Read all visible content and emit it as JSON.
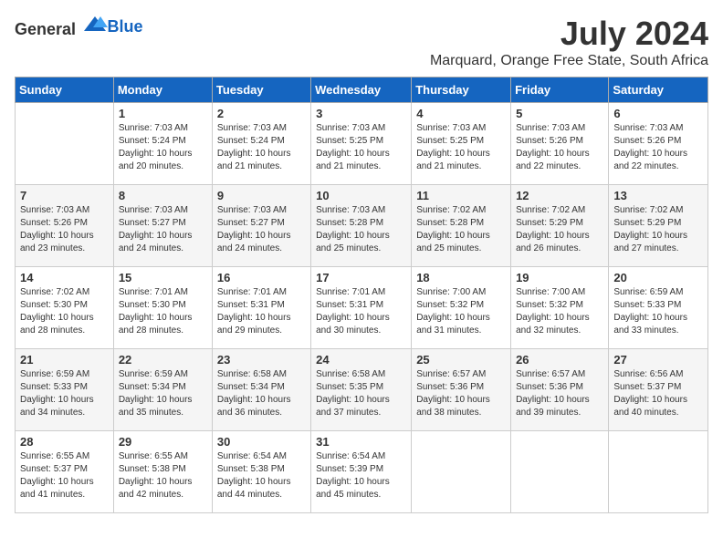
{
  "logo": {
    "text_general": "General",
    "text_blue": "Blue"
  },
  "header": {
    "month_title": "July 2024",
    "location": "Marquard, Orange Free State, South Africa"
  },
  "weekdays": [
    "Sunday",
    "Monday",
    "Tuesday",
    "Wednesday",
    "Thursday",
    "Friday",
    "Saturday"
  ],
  "weeks": [
    [
      {
        "day": "",
        "sunrise": "",
        "sunset": "",
        "daylight": ""
      },
      {
        "day": "1",
        "sunrise": "Sunrise: 7:03 AM",
        "sunset": "Sunset: 5:24 PM",
        "daylight": "Daylight: 10 hours and 20 minutes."
      },
      {
        "day": "2",
        "sunrise": "Sunrise: 7:03 AM",
        "sunset": "Sunset: 5:24 PM",
        "daylight": "Daylight: 10 hours and 21 minutes."
      },
      {
        "day": "3",
        "sunrise": "Sunrise: 7:03 AM",
        "sunset": "Sunset: 5:25 PM",
        "daylight": "Daylight: 10 hours and 21 minutes."
      },
      {
        "day": "4",
        "sunrise": "Sunrise: 7:03 AM",
        "sunset": "Sunset: 5:25 PM",
        "daylight": "Daylight: 10 hours and 21 minutes."
      },
      {
        "day": "5",
        "sunrise": "Sunrise: 7:03 AM",
        "sunset": "Sunset: 5:26 PM",
        "daylight": "Daylight: 10 hours and 22 minutes."
      },
      {
        "day": "6",
        "sunrise": "Sunrise: 7:03 AM",
        "sunset": "Sunset: 5:26 PM",
        "daylight": "Daylight: 10 hours and 22 minutes."
      }
    ],
    [
      {
        "day": "7",
        "sunrise": "Sunrise: 7:03 AM",
        "sunset": "Sunset: 5:26 PM",
        "daylight": "Daylight: 10 hours and 23 minutes."
      },
      {
        "day": "8",
        "sunrise": "Sunrise: 7:03 AM",
        "sunset": "Sunset: 5:27 PM",
        "daylight": "Daylight: 10 hours and 24 minutes."
      },
      {
        "day": "9",
        "sunrise": "Sunrise: 7:03 AM",
        "sunset": "Sunset: 5:27 PM",
        "daylight": "Daylight: 10 hours and 24 minutes."
      },
      {
        "day": "10",
        "sunrise": "Sunrise: 7:03 AM",
        "sunset": "Sunset: 5:28 PM",
        "daylight": "Daylight: 10 hours and 25 minutes."
      },
      {
        "day": "11",
        "sunrise": "Sunrise: 7:02 AM",
        "sunset": "Sunset: 5:28 PM",
        "daylight": "Daylight: 10 hours and 25 minutes."
      },
      {
        "day": "12",
        "sunrise": "Sunrise: 7:02 AM",
        "sunset": "Sunset: 5:29 PM",
        "daylight": "Daylight: 10 hours and 26 minutes."
      },
      {
        "day": "13",
        "sunrise": "Sunrise: 7:02 AM",
        "sunset": "Sunset: 5:29 PM",
        "daylight": "Daylight: 10 hours and 27 minutes."
      }
    ],
    [
      {
        "day": "14",
        "sunrise": "Sunrise: 7:02 AM",
        "sunset": "Sunset: 5:30 PM",
        "daylight": "Daylight: 10 hours and 28 minutes."
      },
      {
        "day": "15",
        "sunrise": "Sunrise: 7:01 AM",
        "sunset": "Sunset: 5:30 PM",
        "daylight": "Daylight: 10 hours and 28 minutes."
      },
      {
        "day": "16",
        "sunrise": "Sunrise: 7:01 AM",
        "sunset": "Sunset: 5:31 PM",
        "daylight": "Daylight: 10 hours and 29 minutes."
      },
      {
        "day": "17",
        "sunrise": "Sunrise: 7:01 AM",
        "sunset": "Sunset: 5:31 PM",
        "daylight": "Daylight: 10 hours and 30 minutes."
      },
      {
        "day": "18",
        "sunrise": "Sunrise: 7:00 AM",
        "sunset": "Sunset: 5:32 PM",
        "daylight": "Daylight: 10 hours and 31 minutes."
      },
      {
        "day": "19",
        "sunrise": "Sunrise: 7:00 AM",
        "sunset": "Sunset: 5:32 PM",
        "daylight": "Daylight: 10 hours and 32 minutes."
      },
      {
        "day": "20",
        "sunrise": "Sunrise: 6:59 AM",
        "sunset": "Sunset: 5:33 PM",
        "daylight": "Daylight: 10 hours and 33 minutes."
      }
    ],
    [
      {
        "day": "21",
        "sunrise": "Sunrise: 6:59 AM",
        "sunset": "Sunset: 5:33 PM",
        "daylight": "Daylight: 10 hours and 34 minutes."
      },
      {
        "day": "22",
        "sunrise": "Sunrise: 6:59 AM",
        "sunset": "Sunset: 5:34 PM",
        "daylight": "Daylight: 10 hours and 35 minutes."
      },
      {
        "day": "23",
        "sunrise": "Sunrise: 6:58 AM",
        "sunset": "Sunset: 5:34 PM",
        "daylight": "Daylight: 10 hours and 36 minutes."
      },
      {
        "day": "24",
        "sunrise": "Sunrise: 6:58 AM",
        "sunset": "Sunset: 5:35 PM",
        "daylight": "Daylight: 10 hours and 37 minutes."
      },
      {
        "day": "25",
        "sunrise": "Sunrise: 6:57 AM",
        "sunset": "Sunset: 5:36 PM",
        "daylight": "Daylight: 10 hours and 38 minutes."
      },
      {
        "day": "26",
        "sunrise": "Sunrise: 6:57 AM",
        "sunset": "Sunset: 5:36 PM",
        "daylight": "Daylight: 10 hours and 39 minutes."
      },
      {
        "day": "27",
        "sunrise": "Sunrise: 6:56 AM",
        "sunset": "Sunset: 5:37 PM",
        "daylight": "Daylight: 10 hours and 40 minutes."
      }
    ],
    [
      {
        "day": "28",
        "sunrise": "Sunrise: 6:55 AM",
        "sunset": "Sunset: 5:37 PM",
        "daylight": "Daylight: 10 hours and 41 minutes."
      },
      {
        "day": "29",
        "sunrise": "Sunrise: 6:55 AM",
        "sunset": "Sunset: 5:38 PM",
        "daylight": "Daylight: 10 hours and 42 minutes."
      },
      {
        "day": "30",
        "sunrise": "Sunrise: 6:54 AM",
        "sunset": "Sunset: 5:38 PM",
        "daylight": "Daylight: 10 hours and 44 minutes."
      },
      {
        "day": "31",
        "sunrise": "Sunrise: 6:54 AM",
        "sunset": "Sunset: 5:39 PM",
        "daylight": "Daylight: 10 hours and 45 minutes."
      },
      {
        "day": "",
        "sunrise": "",
        "sunset": "",
        "daylight": ""
      },
      {
        "day": "",
        "sunrise": "",
        "sunset": "",
        "daylight": ""
      },
      {
        "day": "",
        "sunrise": "",
        "sunset": "",
        "daylight": ""
      }
    ]
  ]
}
